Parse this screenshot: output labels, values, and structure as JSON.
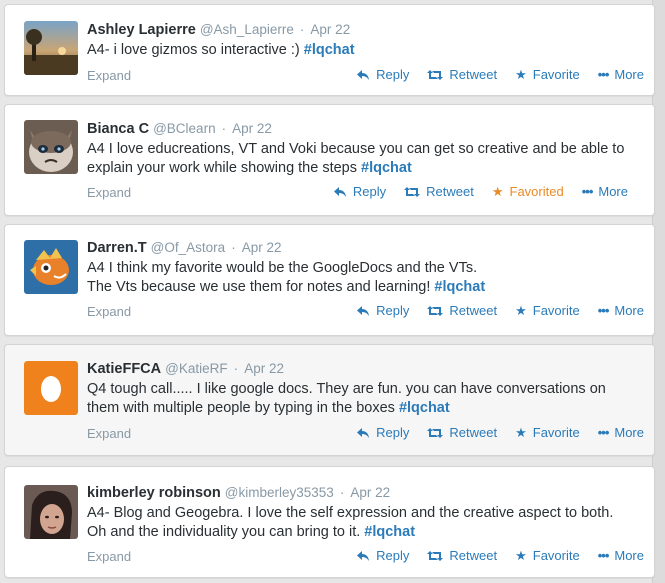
{
  "actions": {
    "expand": "Expand",
    "reply": "Reply",
    "retweet": "Retweet",
    "favorite": "Favorite",
    "favorited": "Favorited",
    "more": "More"
  },
  "tweets": [
    {
      "name": "Ashley Lapierre",
      "handle": "@Ash_Lapierre",
      "date": "Apr 22",
      "text": "A4- i love gizmos so interactive :) ",
      "tag": "#lqchat",
      "favorited": false
    },
    {
      "name": "Bianca C",
      "handle": "@BClearn",
      "date": "Apr 22",
      "text": "A4 I love educreations, VT and Voki because you can get so creative and be able to explain your work while showing the steps ",
      "tag": "#lqchat",
      "favorited": true
    },
    {
      "name": "Darren.T",
      "handle": "@Of_Astora",
      "date": "Apr 22",
      "text_line1": "A4 I think my favorite would be the GoogleDocs and the VTs.",
      "text": "The Vts because we use them for notes and learning! ",
      "tag": "#lqchat",
      "favorited": false
    },
    {
      "name": "KatieFFCA",
      "handle": "@KatieRF",
      "date": "Apr 22",
      "text": "Q4 tough call..... I like google docs. They are fun. you can have conversations on them with multiple people by typing in the boxes ",
      "tag": "#lqchat",
      "favorited": false
    },
    {
      "name": "kimberley robinson",
      "handle": "@kimberley35353",
      "date": "Apr 22",
      "text": "A4- Blog and Geogebra. I love the self expression and the creative aspect to both. Oh and the individuality you can bring to it.  ",
      "tag": "#lqchat",
      "favorited": false
    }
  ]
}
